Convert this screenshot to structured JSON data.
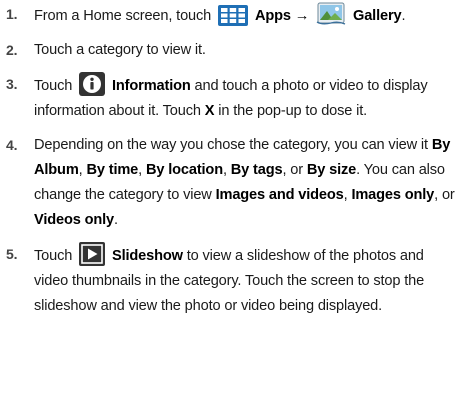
{
  "steps": [
    {
      "number": "1.",
      "t1": "From a Home screen, touch",
      "apps_label": "Apps",
      "arrow": "→",
      "gallery_label": "Gallery",
      "t2": ".",
      "icons": [
        "apps-grid-icon",
        "gallery-icon"
      ]
    },
    {
      "number": "2.",
      "text": "Touch a category to view it."
    },
    {
      "number": "3.",
      "t1": "Touch",
      "information_label": "Information",
      "t2": "and touch a photo or video to display information about it. Touch",
      "x_label": "X",
      "t3": "in the pop-up to dose it.",
      "icons": [
        "information-icon"
      ]
    },
    {
      "number": "4.",
      "t1": "Depending on the way you chose the category, you can view it",
      "b1": "By Album",
      "t2": ",",
      "b2": "By time",
      "t3": ",",
      "b3": "By location",
      "t4": ",",
      "b4": "By tags",
      "t5": ", or",
      "b5": "By size",
      "t6": ". You can also change the category to view",
      "b6": "Images and videos",
      "t7": ",",
      "b7": "Images only",
      "t8": ", or",
      "b8": "Videos only",
      "t9": "."
    },
    {
      "number": "5.",
      "t1": "Touch",
      "slideshow_label": "Slideshow",
      "t2": "to view a slideshow of the photos and video thumbnails in the category. Touch the screen to stop the slideshow and view the photo or video being displayed.",
      "icons": [
        "slideshow-play-icon"
      ]
    }
  ],
  "colors": {
    "text": "#1a1a1a",
    "icon_blue": "#1f6fb5",
    "icon_dark": "#333333"
  }
}
